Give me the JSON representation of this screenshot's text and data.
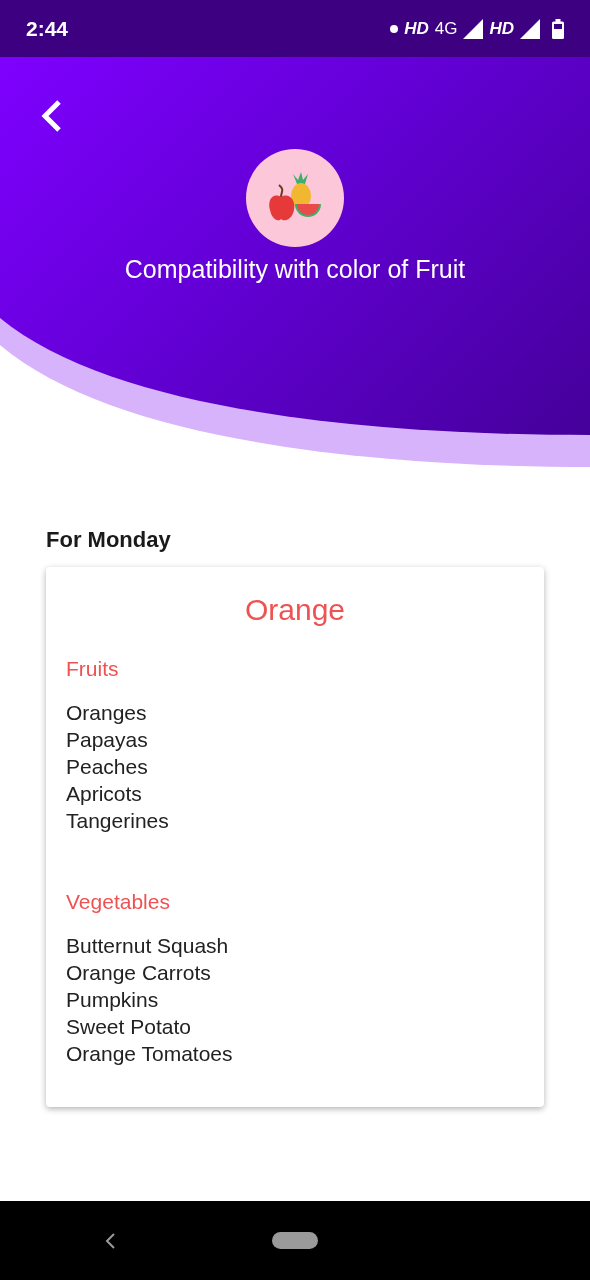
{
  "status_bar": {
    "time": "2:44",
    "indicators": [
      "HD",
      "4G",
      "HD"
    ]
  },
  "header": {
    "title": "Compatibility with color of Fruit"
  },
  "section": {
    "title": "For Monday",
    "card": {
      "color_name": "Orange",
      "groups": [
        {
          "label": "Fruits",
          "items": [
            "Oranges",
            "Papayas",
            "Peaches",
            "Apricots",
            "Tangerines"
          ]
        },
        {
          "label": "Vegetables",
          "items": [
            "Butternut Squash",
            "Orange Carrots",
            "Pumpkins",
            "Sweet Potato",
            "Orange Tomatoes"
          ]
        }
      ]
    }
  }
}
